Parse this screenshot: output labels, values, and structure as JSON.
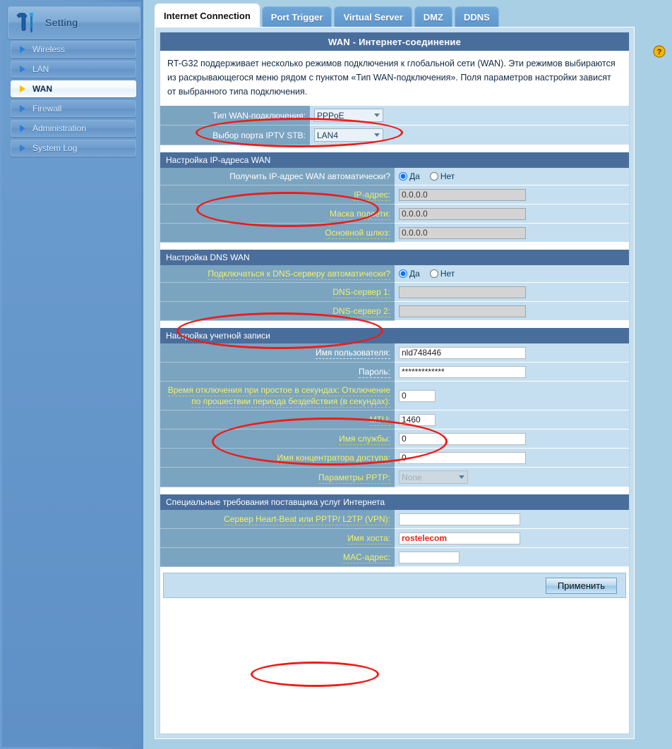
{
  "sidebar": {
    "header": {
      "title": "Setting",
      "icon": "tools-icon"
    },
    "items": [
      {
        "label": "Wireless",
        "active": false
      },
      {
        "label": "LAN",
        "active": false
      },
      {
        "label": "WAN",
        "active": true
      },
      {
        "label": "Firewall",
        "active": false
      },
      {
        "label": "Administration",
        "active": false
      },
      {
        "label": "System Log",
        "active": false
      }
    ]
  },
  "tabs": [
    {
      "label": "Internet Connection",
      "active": true
    },
    {
      "label": "Port Trigger",
      "active": false
    },
    {
      "label": "Virtual Server",
      "active": false
    },
    {
      "label": "DMZ",
      "active": false
    },
    {
      "label": "DDNS",
      "active": false
    }
  ],
  "help": {
    "icon": "help-question-icon",
    "glyph": "?"
  },
  "panel": {
    "title": "WAN - Интернет-соединение",
    "intro": "RT-G32 поддерживает несколько режимов подключения к глобальной сети (WAN). Эти режимов выбираются из раскрывающегося меню рядом с пунктом «Тип WAN-подключения». Поля параметров настройки зависят от выбранного типа подключения.",
    "top_fields": [
      {
        "label": "Тип WAN-подключения:",
        "value": "PPPoE",
        "type": "select",
        "disabled": false
      },
      {
        "label": "Выбор порта IPTV STB:",
        "value": "LAN4",
        "type": "select",
        "disabled": false
      }
    ],
    "groups": [
      {
        "title": "Настройка IP-адреса WAN",
        "rows": [
          {
            "label": "Получить IP-адрес WAN автоматически?",
            "type": "radio",
            "options": [
              "Да",
              "Нет"
            ],
            "selected": "Да",
            "dim": false
          },
          {
            "label": "IP-адрес:",
            "type": "text",
            "value": "0.0.0.0",
            "disabled": true,
            "dim": true,
            "width": "w180"
          },
          {
            "label": "Маска подсети:",
            "type": "text",
            "value": "0.0.0.0",
            "disabled": true,
            "dim": true,
            "width": "w180"
          },
          {
            "label": "Основной шлюз:",
            "type": "text",
            "value": "0.0.0.0",
            "disabled": true,
            "dim": true,
            "width": "w180"
          }
        ]
      },
      {
        "title": "Настройка DNS WAN",
        "rows": [
          {
            "label": "Подключаться к DNS-серверу автоматически?",
            "type": "radio",
            "options": [
              "Да",
              "Нет"
            ],
            "selected": "Да",
            "dim": true
          },
          {
            "label": "DNS-сервер 1:",
            "type": "text",
            "value": "",
            "disabled": true,
            "dim": true,
            "width": "w180"
          },
          {
            "label": "DNS-сервер 2:",
            "type": "text",
            "value": "",
            "disabled": true,
            "dim": true,
            "width": "w180"
          }
        ]
      },
      {
        "title": "Настройка учетной записи",
        "rows": [
          {
            "label": "Имя пользователя:",
            "type": "text",
            "value": "nld748446",
            "disabled": false,
            "dim": false,
            "width": "w180"
          },
          {
            "label": "Пароль:",
            "type": "text",
            "value": "*************",
            "disabled": false,
            "dim": false,
            "width": "w180"
          },
          {
            "label": "Время отключения при простое в секундах: Отключение по прошествии периода бездействия (в секундах):",
            "type": "text",
            "value": "0",
            "disabled": false,
            "dim": true,
            "width": "w60"
          },
          {
            "label": "MTU:",
            "type": "text",
            "value": "1460",
            "disabled": false,
            "dim": true,
            "width": "w60"
          },
          {
            "label": "Имя службы:",
            "type": "text",
            "value": "0",
            "disabled": false,
            "dim": true,
            "width": "w180"
          },
          {
            "label": "Имя концентратора доступа:",
            "type": "text",
            "value": "0",
            "disabled": false,
            "dim": true,
            "width": "w180"
          },
          {
            "label": "Параметры PPTP:",
            "type": "select",
            "value": "None",
            "disabled": true,
            "dim": true
          }
        ]
      },
      {
        "title": "Специальные требования поставщика услуг Интернета",
        "rows": [
          {
            "label": "Сервер Heart-Beat или PPTP/ L2TP (VPN):",
            "type": "text",
            "value": "",
            "disabled": false,
            "dim": true,
            "width": "w170"
          },
          {
            "label": "Имя хоста:",
            "type": "text",
            "value": "rostelecom",
            "disabled": false,
            "dim": true,
            "width": "w170",
            "highlight": true
          },
          {
            "label": "MAC-адрес:",
            "type": "text",
            "value": "",
            "disabled": false,
            "dim": true,
            "width": "w90"
          }
        ]
      }
    ],
    "apply_label": "Применить"
  },
  "annotations": {
    "color": "#ee1b17",
    "notes": [
      "wan-connection-type-highlight",
      "get-wan-ip-automatically-highlight",
      "connect-dns-automatically-highlight",
      "account-credentials-highlight",
      "host-name-highlight"
    ]
  }
}
